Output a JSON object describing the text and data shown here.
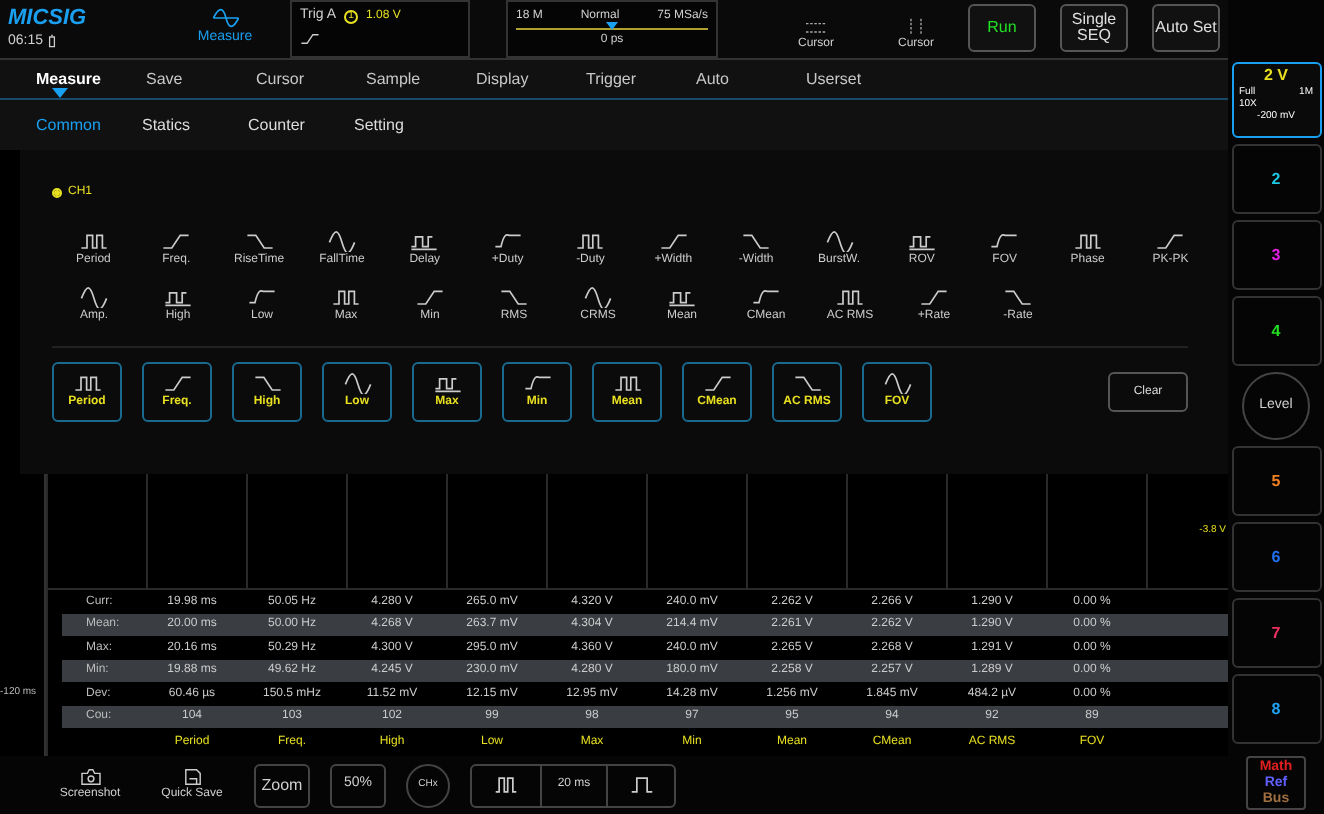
{
  "top_bar": {
    "logo": "MICSIG",
    "time": "06:15",
    "measure": {
      "label": "Measure",
      "selected": true
    },
    "trigger": {
      "label": "Trig A",
      "source": "1",
      "level": "1.08 V"
    },
    "timebase": {
      "memory": "18 M",
      "mode": "Normal",
      "rate": "75 MSa/s",
      "offset": "0 ps",
      "level": 0.5
    },
    "cursors": [
      "Cursor",
      "Cursor"
    ],
    "buttons": [
      {
        "label": "Run",
        "kind": "run"
      },
      {
        "label": "Single SEQ",
        "kind": "plain"
      },
      {
        "label": "Auto Set",
        "kind": "plain"
      }
    ]
  },
  "menu": [
    {
      "label": "Measure",
      "selected": true
    },
    {
      "label": "Save",
      "selected": false
    },
    {
      "label": "Cursor",
      "selected": false
    },
    {
      "label": "Sample",
      "selected": false
    },
    {
      "label": "Display",
      "selected": false
    },
    {
      "label": "Trigger",
      "selected": false
    },
    {
      "label": "Auto",
      "selected": false
    },
    {
      "label": "Userset",
      "selected": false
    }
  ],
  "sub_tabs": [
    {
      "label": "Common",
      "selected": true
    },
    {
      "label": "Statics",
      "selected": false
    },
    {
      "label": "Counter",
      "selected": false
    },
    {
      "label": "Setting",
      "selected": false
    }
  ],
  "channel_option": {
    "label": "CH1",
    "selected": true
  },
  "measurements": [
    [
      "Period",
      "Freq.",
      "RiseTime",
      "FallTime",
      "Delay",
      "+Duty",
      "-Duty",
      "+Width",
      "-Width",
      "BurstW.",
      "ROV",
      "FOV",
      "Phase",
      "PK-PK"
    ],
    [
      "Amp.",
      "High",
      "Low",
      "Max",
      "Min",
      "RMS",
      "CRMS",
      "Mean",
      "CMean",
      "AC RMS",
      "+Rate",
      "-Rate"
    ]
  ],
  "chosen": [
    "Period",
    "Freq.",
    "High",
    "Low",
    "Max",
    "Min",
    "Mean",
    "CMean",
    "AC RMS",
    "FOV"
  ],
  "clear_button": "Clear",
  "grid": {
    "level_label": "-3.8 V",
    "time_label": "-120 ms"
  },
  "table": {
    "rows": [
      {
        "label": "Curr:",
        "values": [
          "19.98 ms",
          "50.05 Hz",
          "4.280 V",
          "265.0 mV",
          "4.320 V",
          "240.0 mV",
          "2.262 V",
          "2.266 V",
          "1.290 V",
          "0.00 %"
        ]
      },
      {
        "label": "Mean:",
        "values": [
          "20.00 ms",
          "50.00 Hz",
          "4.268 V",
          "263.7 mV",
          "4.304 V",
          "214.4 mV",
          "2.261 V",
          "2.262 V",
          "1.290 V",
          "0.00 %"
        ]
      },
      {
        "label": "Max:",
        "values": [
          "20.16 ms",
          "50.29 Hz",
          "4.300 V",
          "295.0 mV",
          "4.360 V",
          "240.0 mV",
          "2.265 V",
          "2.268 V",
          "1.291 V",
          "0.00 %"
        ]
      },
      {
        "label": "Min:",
        "values": [
          "19.88 ms",
          "49.62 Hz",
          "4.245 V",
          "230.0 mV",
          "4.280 V",
          "180.0 mV",
          "2.258 V",
          "2.257 V",
          "1.289 V",
          "0.00 %"
        ]
      },
      {
        "label": "Dev:",
        "values": [
          "60.46 µs",
          "150.5 mHz",
          "11.52 mV",
          "12.15 mV",
          "12.95 mV",
          "14.28 mV",
          "1.256 mV",
          "1.845 mV",
          "484.2 µV",
          "0.00 %"
        ]
      },
      {
        "label": "Cou:",
        "values": [
          "104",
          "103",
          "102",
          "99",
          "98",
          "97",
          "95",
          "94",
          "92",
          "89"
        ]
      }
    ],
    "columns": [
      "Period",
      "Freq.",
      "High",
      "Low",
      "Max",
      "Min",
      "Mean",
      "CMean",
      "AC RMS",
      "FOV"
    ]
  },
  "bottom_bar": {
    "screenshot": "Screenshot",
    "quick_save": "Quick Save",
    "zoom": "Zoom",
    "percent": "50%",
    "chx": "CHx",
    "timebase": "20 ms"
  },
  "channels": [
    {
      "label": "2",
      "color": "#1ec8e0"
    },
    {
      "label": "3",
      "color": "#e020e0"
    },
    {
      "label": "4",
      "color": "#22e022"
    }
  ],
  "channels_lower": [
    {
      "label": "5",
      "color": "#f08020"
    },
    {
      "label": "6",
      "color": "#2070f0"
    },
    {
      "label": "7",
      "color": "#f03060"
    },
    {
      "label": "8",
      "color": "#20a0f0"
    }
  ],
  "ch1": {
    "scale": "2 V",
    "bandwidth": "Full",
    "impedance": "1M",
    "probe": "10X",
    "offset": "-200 mV"
  },
  "level_button": "Level",
  "math_ref_bus": [
    {
      "label": "Math",
      "color": "#e02020"
    },
    {
      "label": "Ref",
      "color": "#6060ff"
    },
    {
      "label": "Bus",
      "color": "#a07040"
    }
  ]
}
